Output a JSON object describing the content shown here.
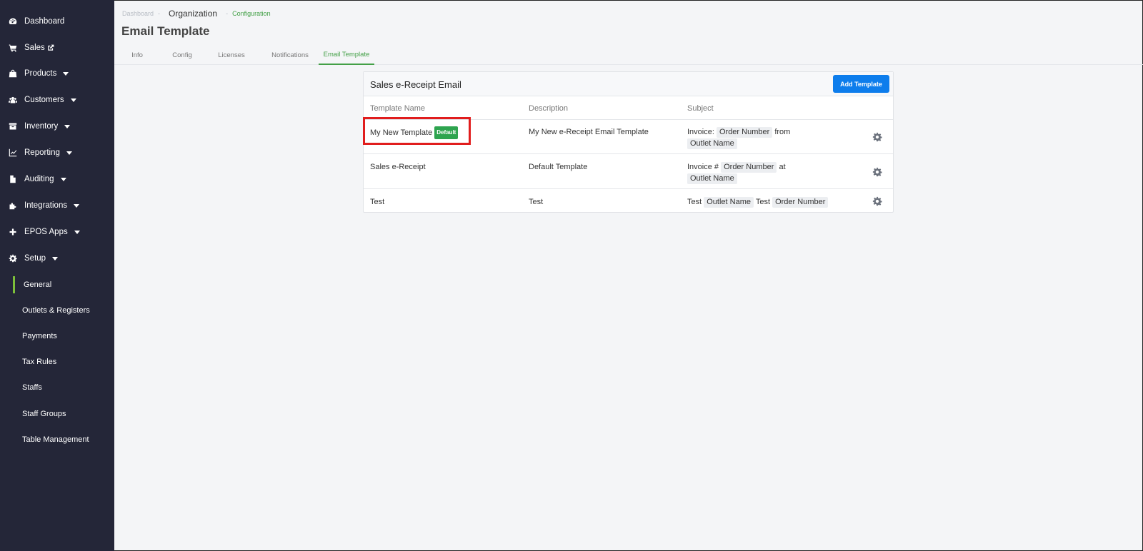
{
  "sidebar": {
    "items": [
      {
        "label": "Dashboard",
        "icon": "dashboard-icon",
        "caret": false
      },
      {
        "label": "Sales",
        "icon": "cart-icon",
        "caret": false,
        "external": true
      },
      {
        "label": "Products",
        "icon": "bag-icon",
        "caret": true
      },
      {
        "label": "Customers",
        "icon": "users-icon",
        "caret": true
      },
      {
        "label": "Inventory",
        "icon": "archive-icon",
        "caret": true
      },
      {
        "label": "Reporting",
        "icon": "chart-line-icon",
        "caret": true
      },
      {
        "label": "Auditing",
        "icon": "file-icon",
        "caret": true
      },
      {
        "label": "Integrations",
        "icon": "puzzle-icon",
        "caret": true
      },
      {
        "label": "EPOS Apps",
        "icon": "plus-icon",
        "caret": true
      },
      {
        "label": "Setup",
        "icon": "gear-icon",
        "caret": true
      }
    ],
    "sub_items": [
      {
        "label": "General",
        "active": true
      },
      {
        "label": "Outlets & Registers"
      },
      {
        "label": "Payments"
      },
      {
        "label": "Tax Rules"
      },
      {
        "label": "Staffs"
      },
      {
        "label": "Staff Groups"
      },
      {
        "label": "Table Management"
      }
    ]
  },
  "breadcrumb": {
    "first": "Dashboard",
    "second": "Organization",
    "third": "Configuration"
  },
  "page_title": "Email Template",
  "tabs": [
    {
      "label": "Info"
    },
    {
      "label": "Config"
    },
    {
      "label": "Licenses"
    },
    {
      "label": "Notifications"
    },
    {
      "label": "Email Template",
      "active": true
    }
  ],
  "card": {
    "title": "Sales e-Receipt Email",
    "add_button": "Add Template",
    "columns": [
      "Template Name",
      "Description",
      "Subject"
    ],
    "rows": [
      {
        "name": "My New Template",
        "badge": "Default",
        "description": "My New e-Receipt Email Template",
        "subject_parts": [
          {
            "text": "Invoice: ",
            "token": false
          },
          {
            "text": "Order Number",
            "token": true
          },
          {
            "text": " from ",
            "token": false
          },
          {
            "text": "Outlet Name",
            "token": true
          }
        ]
      },
      {
        "name": "Sales e-Receipt",
        "badge": "",
        "description": "Default Template",
        "subject_parts": [
          {
            "text": "Invoice # ",
            "token": false
          },
          {
            "text": "Order Number",
            "token": true
          },
          {
            "text": " at ",
            "token": false
          },
          {
            "text": "Outlet Name",
            "token": true
          }
        ]
      },
      {
        "name": "Test",
        "badge": "",
        "description": "Test",
        "subject_parts": [
          {
            "text": "Test ",
            "token": false
          },
          {
            "text": "Outlet Name",
            "token": true
          },
          {
            "text": " Test ",
            "token": false
          },
          {
            "text": "Order Number",
            "token": true
          }
        ]
      }
    ]
  },
  "colors": {
    "sidebar_bg": "#242638",
    "accent_green": "#43a047",
    "primary_blue": "#0d7dec",
    "highlight_red": "#e11d1d",
    "badge_green": "#2ea44f"
  }
}
